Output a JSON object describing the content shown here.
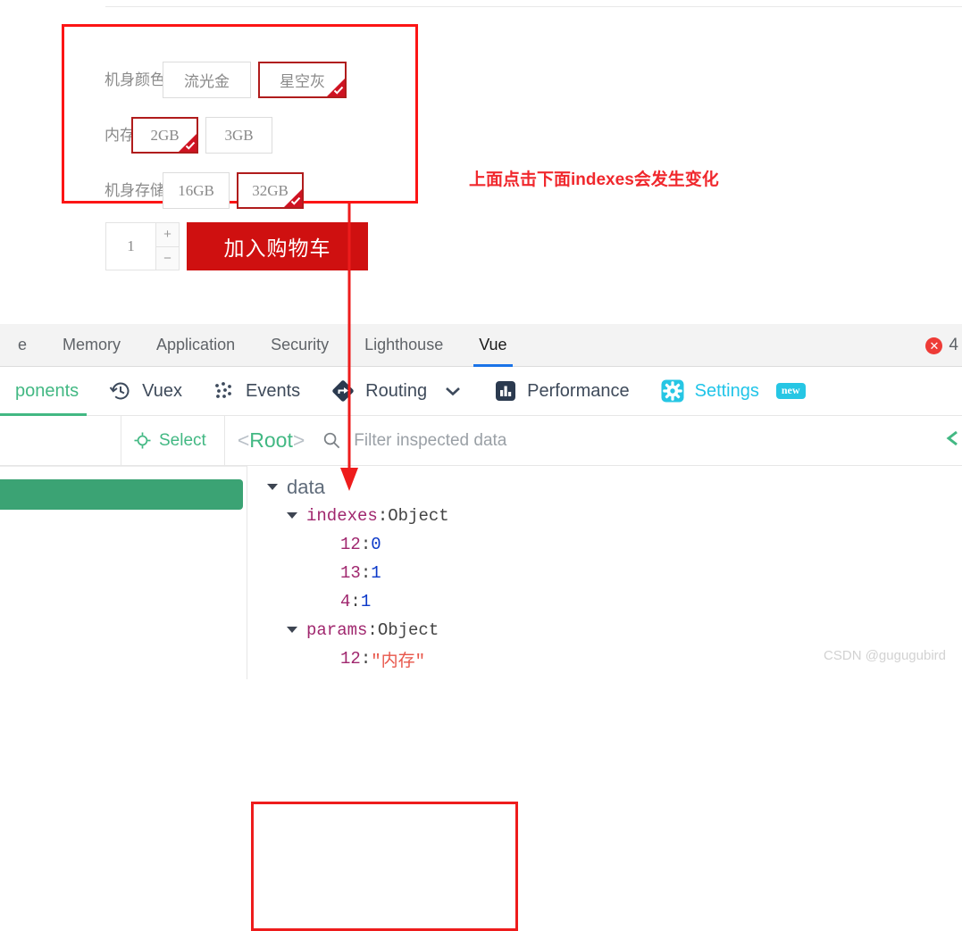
{
  "product": {
    "options": [
      {
        "label": "机身颜色",
        "size": "wide",
        "choices": [
          {
            "text": "流光金",
            "selected": false
          },
          {
            "text": "星空灰",
            "selected": true
          }
        ]
      },
      {
        "label": "内存",
        "size": "narrow",
        "choices": [
          {
            "text": "2GB",
            "selected": true
          },
          {
            "text": "3GB",
            "selected": false
          }
        ]
      },
      {
        "label": "机身存储",
        "size": "narrow",
        "choices": [
          {
            "text": "16GB",
            "selected": false
          },
          {
            "text": "32GB",
            "selected": true
          }
        ]
      }
    ],
    "quantity": "1",
    "increase_label": "+",
    "decrease_label": "−",
    "cart_button": "加入购物车"
  },
  "annotation": {
    "note": "上面点击下面indexes会发生变化",
    "note_color": "#f0282d",
    "box_color": "#fc1515",
    "arrow_color": "#ee1c1c"
  },
  "devtools": {
    "tabs": [
      {
        "label": "e",
        "active": false
      },
      {
        "label": "Memory",
        "active": false
      },
      {
        "label": "Application",
        "active": false
      },
      {
        "label": "Security",
        "active": false
      },
      {
        "label": "Lighthouse",
        "active": false
      },
      {
        "label": "Vue",
        "active": true
      }
    ],
    "error_badge_icon": "✕",
    "error_count": "4",
    "accent_color": "#1a73e8"
  },
  "vue_panel": {
    "tabs": [
      {
        "label": "ponents",
        "icon": "components-icon",
        "active": true,
        "show_icon": false
      },
      {
        "label": "Vuex",
        "icon": "history-icon",
        "active": false,
        "show_icon": true
      },
      {
        "label": "Events",
        "icon": "dots-icon",
        "active": false,
        "show_icon": true
      },
      {
        "label": "Routing",
        "icon": "routing-diamond-icon",
        "active": false,
        "show_icon": true,
        "chevron": true
      },
      {
        "label": "Performance",
        "icon": "bar-chart-icon",
        "active": false,
        "show_icon": true
      },
      {
        "label": "Settings",
        "icon": "gear-icon",
        "active": false,
        "show_icon": true,
        "badge": "new"
      }
    ],
    "select_label": "Select",
    "root_open": "<",
    "root_name": "Root",
    "root_close": ">",
    "filter_placeholder": "Filter inspected data",
    "filter_value": "",
    "brand_green": "#42b883",
    "settings_cyan": "#20c4e8"
  },
  "tree": {
    "root_node": "data",
    "rows": [
      {
        "indent": 0,
        "caret": true,
        "key": "indexes",
        "key_class": "k-purple",
        "sep": ": ",
        "value": "Object",
        "value_class": "k-gray"
      },
      {
        "indent": 1,
        "caret": false,
        "key": "12",
        "key_class": "k-purple",
        "sep": ": ",
        "value": "0",
        "value_class": "v-blue"
      },
      {
        "indent": 1,
        "caret": false,
        "key": "13",
        "key_class": "k-purple",
        "sep": ": ",
        "value": "1",
        "value_class": "v-blue"
      },
      {
        "indent": 1,
        "caret": false,
        "key": "4",
        "key_class": "k-purple",
        "sep": ": ",
        "value": "1",
        "value_class": "v-blue"
      },
      {
        "indent": 0,
        "caret": true,
        "key": "params",
        "key_class": "k-purple",
        "sep": ": ",
        "value": "Object",
        "value_class": "k-gray"
      },
      {
        "indent": 1,
        "caret": false,
        "key": "12",
        "key_class": "k-purple",
        "sep": ": ",
        "value": "\"内存\"",
        "value_class": "v-red"
      }
    ]
  },
  "watermark": "CSDN @gugugubird"
}
